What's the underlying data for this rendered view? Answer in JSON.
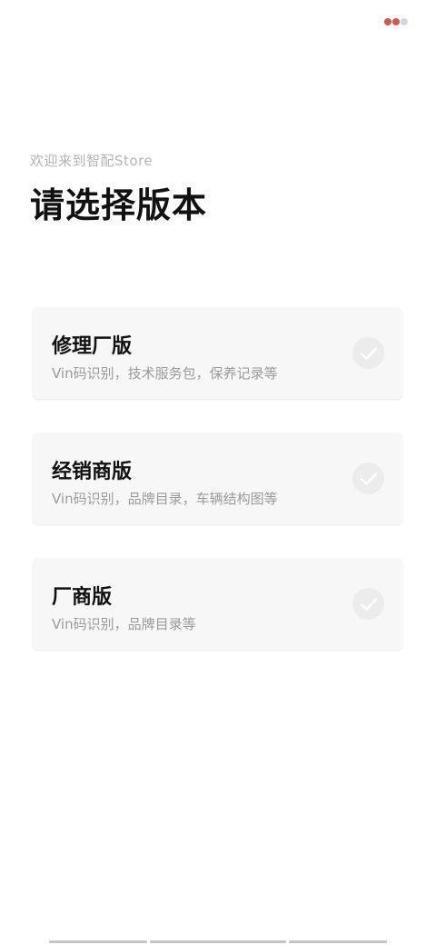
{
  "header": {
    "welcome_text": "欢迎来到智配Store",
    "title": "请选择版本"
  },
  "status_indicators": {
    "colors": [
      "#d9534f",
      "#d9534f",
      "#d6d6d6"
    ]
  },
  "versions": [
    {
      "title": "修理厂版",
      "description": "Vin码识别，技术服务包，保养记录等",
      "selected": false
    },
    {
      "title": "经销商版",
      "description": "Vin码识别，品牌目录，车辆结构图等",
      "selected": false
    },
    {
      "title": "厂商版",
      "description": "Vin码识别，品牌目录等",
      "selected": false
    }
  ],
  "icons": {
    "check": "check-icon"
  }
}
